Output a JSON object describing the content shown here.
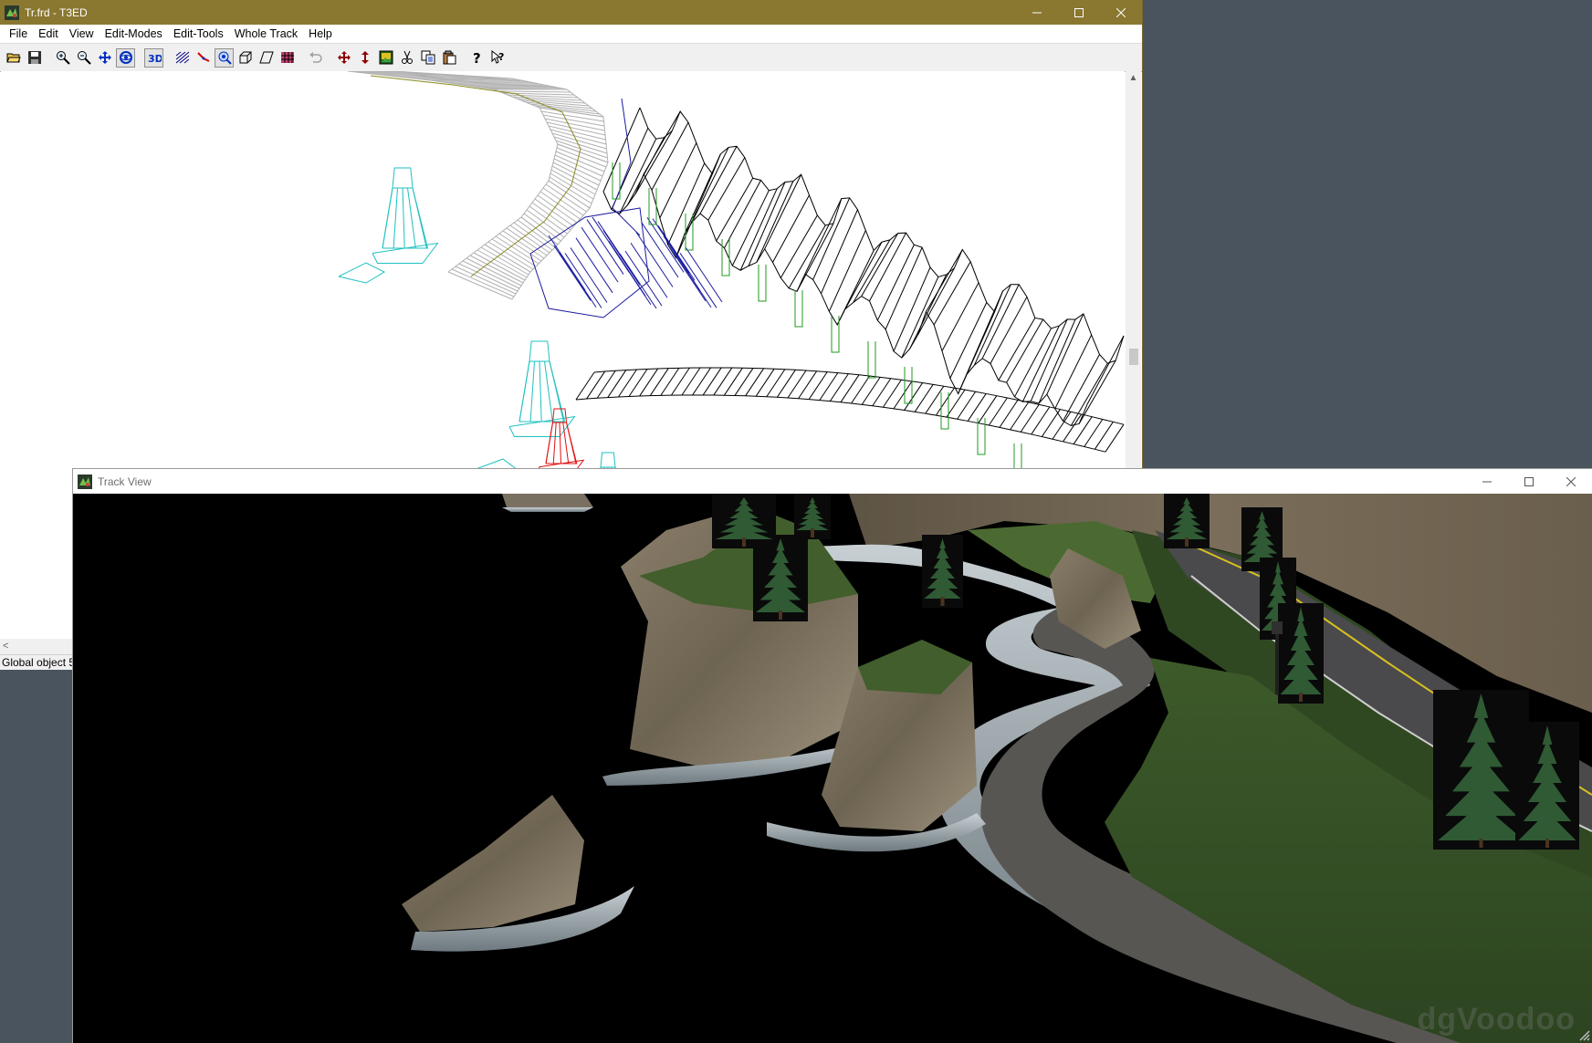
{
  "main_window": {
    "title": "Tr.frd - T3ED",
    "menu": [
      "File",
      "Edit",
      "View",
      "Edit-Modes",
      "Edit-Tools",
      "Whole Track",
      "Help"
    ],
    "status_text": "Global object 5"
  },
  "toolbar": {
    "buttons": [
      {
        "name": "open-icon"
      },
      {
        "name": "save-icon"
      },
      {
        "name": "zoom-in-icon"
      },
      {
        "name": "zoom-out-icon"
      },
      {
        "name": "move-view-icon"
      },
      {
        "name": "rotate-view-icon"
      },
      {
        "name": "3d-view-icon"
      },
      {
        "name": "terrain-icon"
      },
      {
        "name": "road-icon"
      },
      {
        "name": "object-icon"
      },
      {
        "name": "polygon-icon"
      },
      {
        "name": "face-icon"
      },
      {
        "name": "texture-grid-icon"
      },
      {
        "name": "undo-icon"
      },
      {
        "name": "move-icon"
      },
      {
        "name": "vertical-move-icon"
      },
      {
        "name": "image-icon"
      },
      {
        "name": "cut-icon"
      },
      {
        "name": "copy-icon"
      },
      {
        "name": "paste-icon"
      },
      {
        "name": "help-icon"
      },
      {
        "name": "context-help-icon"
      }
    ]
  },
  "track_window": {
    "title": "Track View",
    "watermark": "dgVoodoo"
  },
  "colors": {
    "main_titlebar": "#8a7730",
    "desktop": "#4a545e",
    "wire_black": "#000000",
    "wire_blue": "#1a1aa0",
    "wire_green": "#1f9a1f",
    "wire_cyan": "#1fc0c0",
    "wire_red": "#e01010",
    "wire_grey": "#b0b0b0",
    "wire_olive": "#8a8a20"
  }
}
